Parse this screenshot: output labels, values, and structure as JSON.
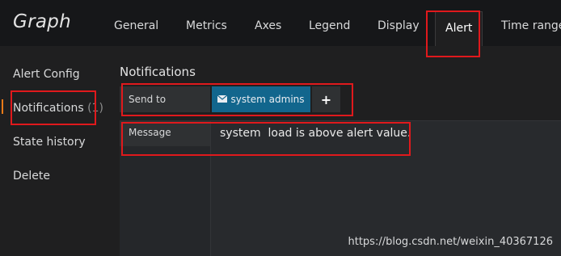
{
  "panel": {
    "title": "Graph"
  },
  "tabs": [
    {
      "label": "General",
      "active": false
    },
    {
      "label": "Metrics",
      "active": false
    },
    {
      "label": "Axes",
      "active": false
    },
    {
      "label": "Legend",
      "active": false
    },
    {
      "label": "Display",
      "active": false
    },
    {
      "label": "Alert",
      "active": true
    },
    {
      "label": "Time range",
      "active": false
    }
  ],
  "sidebar": {
    "items": [
      {
        "label": "Alert Config"
      },
      {
        "label": "Notifications",
        "count": "(1)"
      },
      {
        "label": "State history"
      },
      {
        "label": "Delete"
      }
    ]
  },
  "notifications": {
    "title": "Notifications",
    "send_to_label": "Send to",
    "recipient": "system admins",
    "recipient_icon": "envelope-icon",
    "add_label": "+",
    "message_label": "Message",
    "message_value": "system  load is above alert value."
  },
  "watermark": "https://blog.csdn.net/weixin_40367126",
  "colors": {
    "accent": "#eb7b18",
    "chip": "#12668d",
    "highlight": "#e0191c",
    "background": "#161719"
  }
}
